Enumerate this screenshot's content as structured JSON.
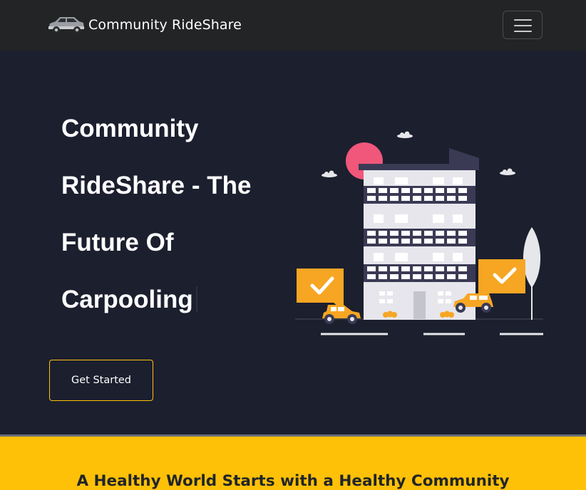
{
  "navbar": {
    "brand_text": "Community RideShare",
    "logo_icon": "car-icon",
    "menu_icon": "hamburger-menu-icon"
  },
  "hero": {
    "title_lines": [
      "Community",
      "RideShare - The",
      "Future Of",
      "Carpooling"
    ],
    "cta_label": "Get Started"
  },
  "section": {
    "heading": "A Healthy World Starts with a Healthy Community"
  },
  "colors": {
    "navbar_bg": "#222426",
    "hero_bg": "#1c1f2e",
    "accent": "#ffc107",
    "illustration_orange": "#f6a623",
    "illustration_pink": "#f0577a"
  }
}
